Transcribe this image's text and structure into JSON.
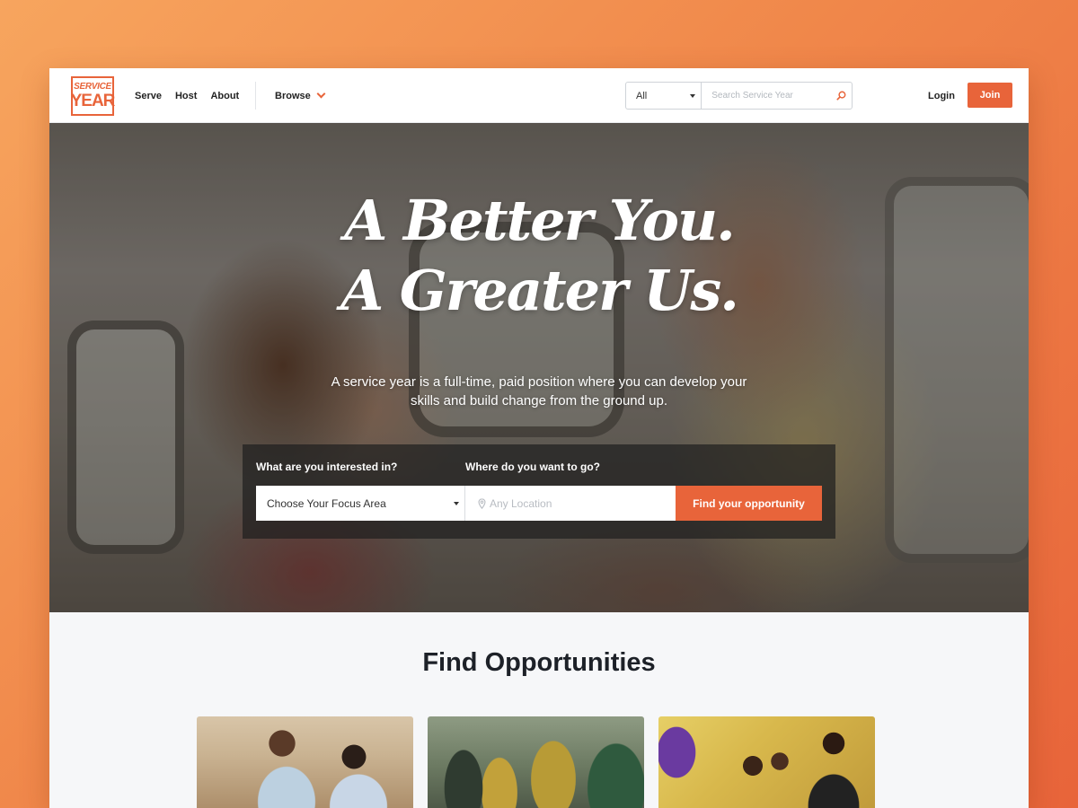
{
  "brand": {
    "logo_line1": "SERVICE",
    "logo_line2": "YEAR"
  },
  "nav": {
    "serve": "Serve",
    "host": "Host",
    "about": "About",
    "browse": "Browse"
  },
  "search": {
    "scope": "All",
    "placeholder": "Search Service Year"
  },
  "account": {
    "login": "Login",
    "join": "Join"
  },
  "hero": {
    "headline_line1": "A Better You.",
    "headline_line2": "A Greater Us.",
    "subhead_line1": "A service year is a full-time, paid position where you can develop your",
    "subhead_line2": "skills and build change from the ground up."
  },
  "finder": {
    "interest_label": "What are you interested in?",
    "location_label": "Where do you want to go?",
    "focus_value": "Choose Your Focus Area",
    "location_placeholder": "Any Location",
    "cta": "Find your opportunity"
  },
  "opportunities": {
    "title": "Find Opportunities"
  },
  "colors": {
    "accent": "#e8643a",
    "text_dark": "#1d2128"
  },
  "icons": [
    "search-icon",
    "chevron-down-icon",
    "location-pin-icon",
    "caret-down-icon"
  ]
}
